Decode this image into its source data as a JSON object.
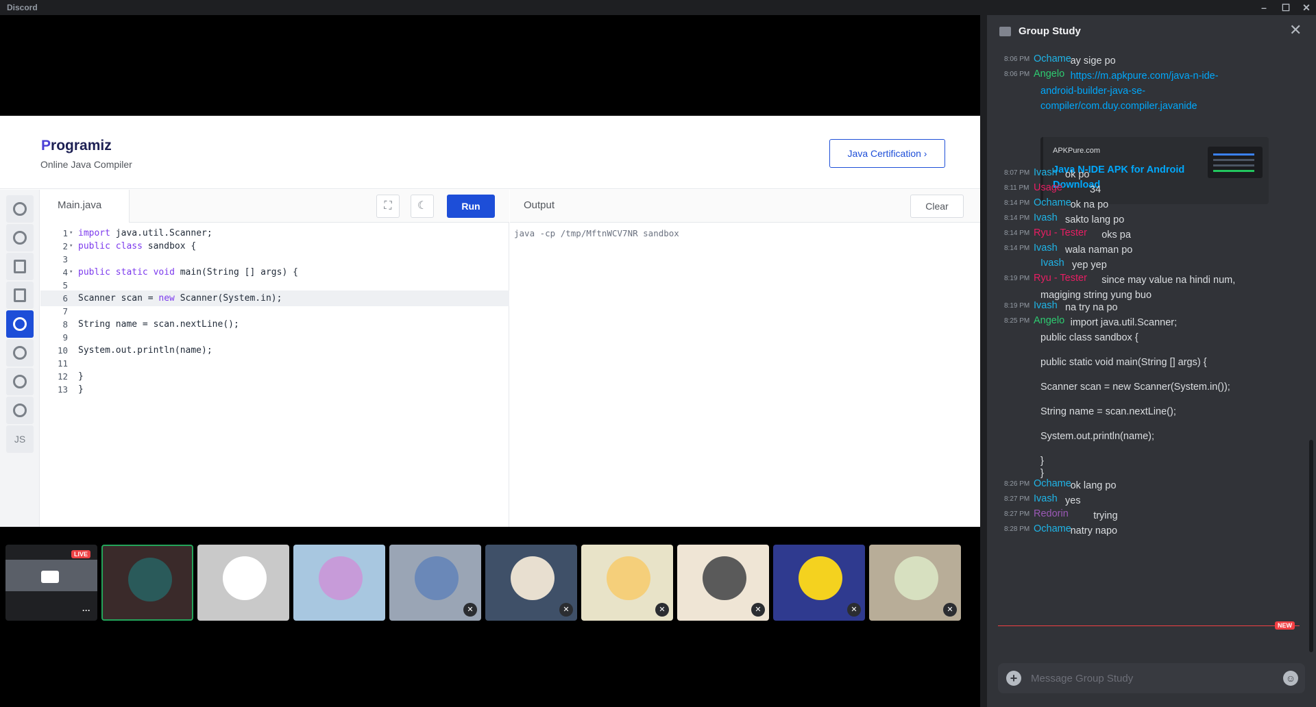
{
  "app": {
    "title": "Discord"
  },
  "programiz": {
    "logo": "rogramiz",
    "logo_p": "P",
    "subtitle": "Online Java Compiler",
    "cert_button": "Java Certification ›",
    "file_tab": "Main.java",
    "run_label": "Run",
    "output_title": "Output",
    "clear_label": "Clear",
    "output_text": "java -cp /tmp/MftnWCV7NR sandbox",
    "lang_js": "JS",
    "code": [
      {
        "n": "1",
        "t": "import java.util.Scanner;",
        "fold": true
      },
      {
        "n": "2",
        "t": "public class sandbox {",
        "fold": true
      },
      {
        "n": "3",
        "t": ""
      },
      {
        "n": "4",
        "t": "public static void main(String [] args) {",
        "fold": true
      },
      {
        "n": "5",
        "t": ""
      },
      {
        "n": "6",
        "t": "Scanner scan = new Scanner(System.in);"
      },
      {
        "n": "7",
        "t": ""
      },
      {
        "n": "8",
        "t": "String name = scan.nextLine();"
      },
      {
        "n": "9",
        "t": ""
      },
      {
        "n": "10",
        "t": "System.out.println(name);"
      },
      {
        "n": "11",
        "t": ""
      },
      {
        "n": "12",
        "t": "}"
      },
      {
        "n": "13",
        "t": "}"
      }
    ]
  },
  "stream": {
    "live_badge": "LIVE"
  },
  "chat": {
    "title": "Group Study",
    "placeholder": "Message Group Study",
    "new_tag": "NEW",
    "messages": [
      {
        "ts": "8:06 PM",
        "author": "Ochame",
        "color": "#1fb5e8",
        "text": "ay sige po"
      },
      {
        "ts": "8:06 PM",
        "author": "Angelo",
        "color": "#2ecc71",
        "link1": "https://m.apkpure.com/java-n-ide-",
        "link2": "android-builder-java-se-",
        "link3": "compiler/com.duy.compiler.javanide"
      },
      {
        "ts": "8:07 PM",
        "author": "Ivash",
        "color": "#1fb5e8",
        "text": "ok po"
      },
      {
        "ts": "8:11 PM",
        "author": "Usage",
        "color": "#e91e63",
        "text": "34"
      },
      {
        "ts": "8:14 PM",
        "author": "Ochame",
        "color": "#1fb5e8",
        "text": "ok na po"
      },
      {
        "ts": "8:14 PM",
        "author": "Ivash",
        "color": "#1fb5e8",
        "text": "sakto lang po"
      },
      {
        "ts": "8:14 PM",
        "author": "Ryu - Tester",
        "color": "#e91e63",
        "text": "oks pa"
      },
      {
        "ts": "8:14 PM",
        "author": "Ivash",
        "color": "#1fb5e8",
        "text": "wala naman po"
      },
      {
        "ts": "",
        "author": "Ivash",
        "color": "#1fb5e8",
        "text": "yep yep"
      },
      {
        "ts": "8:19 PM",
        "author": "Ryu - Tester",
        "color": "#e91e63",
        "text": "since may value na hindi num,",
        "text2": "magiging string yung buo"
      },
      {
        "ts": "8:19 PM",
        "author": "Ivash",
        "color": "#1fb5e8",
        "text": "na try na po"
      },
      {
        "ts": "8:25 PM",
        "author": "Angelo",
        "color": "#2ecc71",
        "text": "import java.util.Scanner;",
        "lines": [
          "public class sandbox {",
          "public static void main(String [] args) {",
          "Scanner scan = new Scanner(System.in());",
          "String name = scan.nextLine();",
          "System.out.println(name);",
          "}",
          "}"
        ]
      },
      {
        "ts": "8:26 PM",
        "author": "Ochame",
        "color": "#1fb5e8",
        "text": "ok lang po"
      },
      {
        "ts": "8:27 PM",
        "author": "Ivash",
        "color": "#1fb5e8",
        "text": "yes"
      },
      {
        "ts": "8:27 PM",
        "author": "Redorin",
        "color": "#9b59b6",
        "text": "trying"
      },
      {
        "ts": "8:28 PM",
        "author": "Ochame",
        "color": "#1fb5e8",
        "text": "natry napo"
      }
    ],
    "embed": {
      "provider": "APKPure.com",
      "title": "Java N-IDE APK for Android Download"
    }
  }
}
